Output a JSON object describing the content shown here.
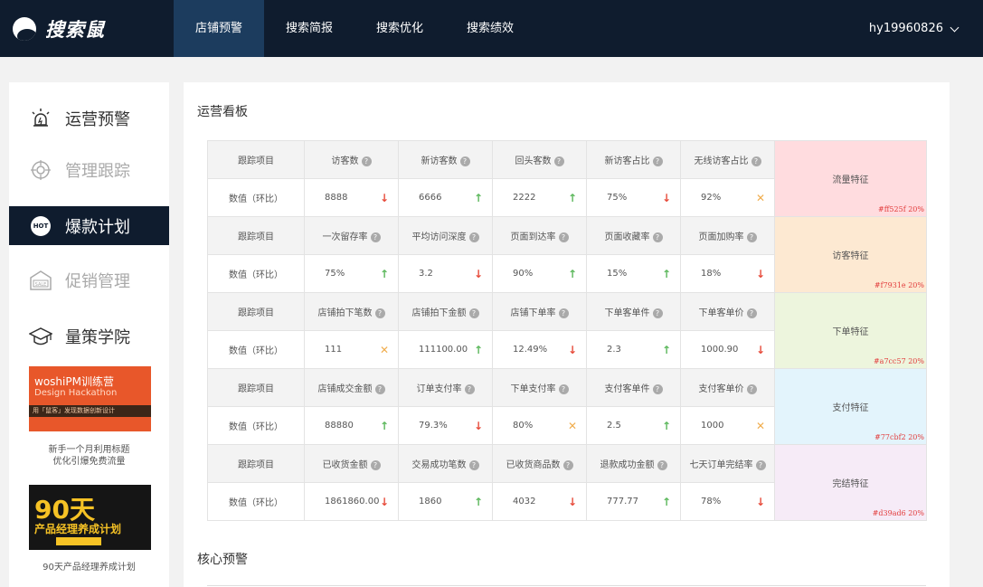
{
  "header": {
    "logo_text": "搜索鼠",
    "nav": [
      "店铺预警",
      "搜索简报",
      "搜索优化",
      "搜索绩效"
    ],
    "active_nav": "店铺预警",
    "user": "hy19960826"
  },
  "sidebar": {
    "items": [
      {
        "label": "运营预警",
        "icon": "alarm-icon",
        "state": "normal"
      },
      {
        "label": "管理跟踪",
        "icon": "target-icon",
        "state": "disabled"
      },
      {
        "label": "爆款计划",
        "icon": "hot-icon",
        "state": "active"
      },
      {
        "label": "促销管理",
        "icon": "sale-icon",
        "state": "disabled"
      },
      {
        "label": "量策学院",
        "icon": "graduation-cap-icon",
        "state": "normal"
      }
    ],
    "hot_badge": "HOT",
    "sale_badge": "SALE",
    "banner1": {
      "line1": "woshiPM训练营",
      "line2": "Design Hackathon",
      "line3": "用「鼠客」发现数据创新设计",
      "caption_line1": "新手一个月利用标题",
      "caption_line2": "优化引爆免费流量"
    },
    "banner2": {
      "big": "90天",
      "title": "产品经理养成计划",
      "caption": "90天产品经理养成计划"
    }
  },
  "main": {
    "dashboard_title": "运营看板",
    "core_title": "核心预警",
    "row_header_label": "跟踪项目",
    "row_value_label": "数值（环比）",
    "help_glyph": "?",
    "colors": {
      "up": "#5cb85c",
      "down": "#e74c3c",
      "flat": "#f0ad4e"
    },
    "groups": [
      {
        "feature": "流量特征",
        "color_note": "#ff525f 20%",
        "bg": "#ffdcdf",
        "metrics": [
          {
            "name": "访客数",
            "value": "8888",
            "trend": "down"
          },
          {
            "name": "新访客数",
            "value": "6666",
            "trend": "up"
          },
          {
            "name": "回头客数",
            "value": "2222",
            "trend": "up"
          },
          {
            "name": "新访客占比",
            "value": "75%",
            "trend": "down"
          },
          {
            "name": "无线访客占比",
            "value": "92%",
            "trend": "flat"
          }
        ]
      },
      {
        "feature": "访客特征",
        "color_note": "#f7931e 20%",
        "bg": "#fde9d2",
        "metrics": [
          {
            "name": "一次留存率",
            "value": "75%",
            "trend": "up"
          },
          {
            "name": "平均访问深度",
            "value": "3.2",
            "trend": "down"
          },
          {
            "name": "页面到达率",
            "value": "90%",
            "trend": "up"
          },
          {
            "name": "页面收藏率",
            "value": "15%",
            "trend": "up"
          },
          {
            "name": "页面加购率",
            "value": "18%",
            "trend": "down"
          }
        ]
      },
      {
        "feature": "下单特征",
        "color_note": "#a7cc57 20%",
        "bg": "#edf5dd",
        "metrics": [
          {
            "name": "店铺拍下笔数",
            "value": "111",
            "trend": "flat"
          },
          {
            "name": "店铺拍下金额",
            "value": "111100.00",
            "trend": "up"
          },
          {
            "name": "店铺下单率",
            "value": "12.49%",
            "trend": "down"
          },
          {
            "name": "下单客单件",
            "value": "2.3",
            "trend": "up"
          },
          {
            "name": "下单客单价",
            "value": "1000.90",
            "trend": "down"
          }
        ]
      },
      {
        "feature": "支付特征",
        "color_note": "#77cbf2 20%",
        "bg": "#e3f4fc",
        "metrics": [
          {
            "name": "店铺成交金额",
            "value": "88880",
            "trend": "up"
          },
          {
            "name": "订单支付率",
            "value": "79.3%",
            "trend": "down"
          },
          {
            "name": "下单支付率",
            "value": "80%",
            "trend": "flat"
          },
          {
            "name": "支付客单件",
            "value": "2.5",
            "trend": "up"
          },
          {
            "name": "支付客单价",
            "value": "1000",
            "trend": "flat"
          }
        ]
      },
      {
        "feature": "完结特征",
        "color_note": "#d39ad6 20%",
        "bg": "#f6ebf7",
        "metrics": [
          {
            "name": "已收货金额",
            "value": "1861860.00",
            "trend": "down"
          },
          {
            "name": "交易成功笔数",
            "value": "1860",
            "trend": "up"
          },
          {
            "name": "已收货商品数",
            "value": "4032",
            "trend": "down"
          },
          {
            "name": "退款成功金额",
            "value": "777.77",
            "trend": "up"
          },
          {
            "name": "七天订单完结率",
            "value": "78%",
            "trend": "down"
          }
        ]
      }
    ]
  }
}
